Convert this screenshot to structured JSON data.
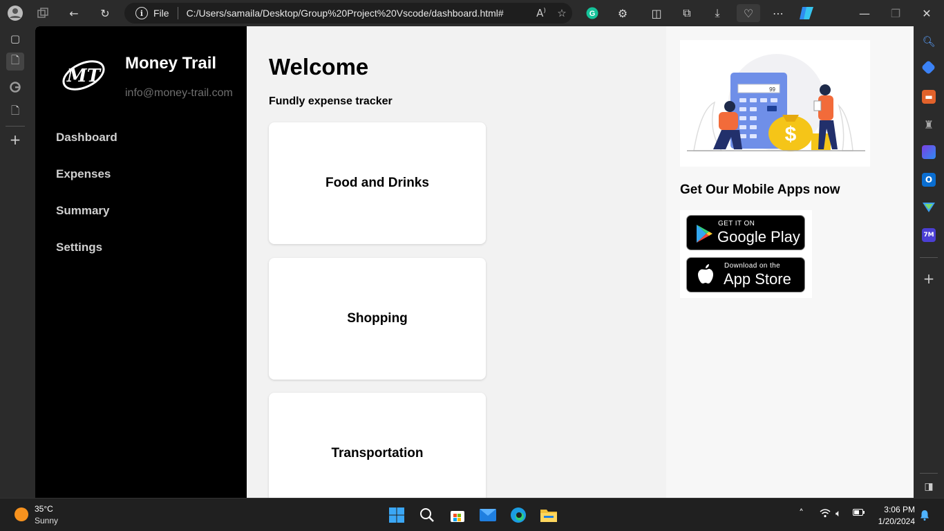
{
  "browser": {
    "address_label": "File",
    "url": "C:/Users/samaila/Desktop/Group%20Project%20Vscode/dashboard.html#",
    "grammarly_letter": "G"
  },
  "sidebar": {
    "brand": "Money Trail",
    "email": "info@money-trail.com",
    "logo_text": "MT",
    "items": [
      {
        "label": "Dashboard"
      },
      {
        "label": "Expenses"
      },
      {
        "label": "Summary"
      },
      {
        "label": "Settings"
      }
    ]
  },
  "main": {
    "title": "Welcome",
    "subtitle": "Fundly expense tracker",
    "cards": [
      {
        "label": "Food and Drinks"
      },
      {
        "label": "Shopping"
      },
      {
        "label": "Transportation"
      }
    ]
  },
  "right": {
    "illustration_value": "99",
    "apps_title": "Get Our Mobile Apps now",
    "google_play": {
      "small": "GET IT ON",
      "big": "Google Play"
    },
    "app_store": {
      "small": "Download on the",
      "big": "App Store"
    }
  },
  "right_sidebar": {
    "badge_text": "7M"
  },
  "taskbar": {
    "temperature": "35°C",
    "condition": "Sunny",
    "time": "3:06 PM",
    "date": "1/20/2024"
  },
  "colors": {
    "sidebar_bg": "#000000",
    "main_bg": "#f2f2f2",
    "card_bg": "#ffffff",
    "illustration_accent": "#f5c518",
    "illustration_blue": "#5b7be0"
  }
}
